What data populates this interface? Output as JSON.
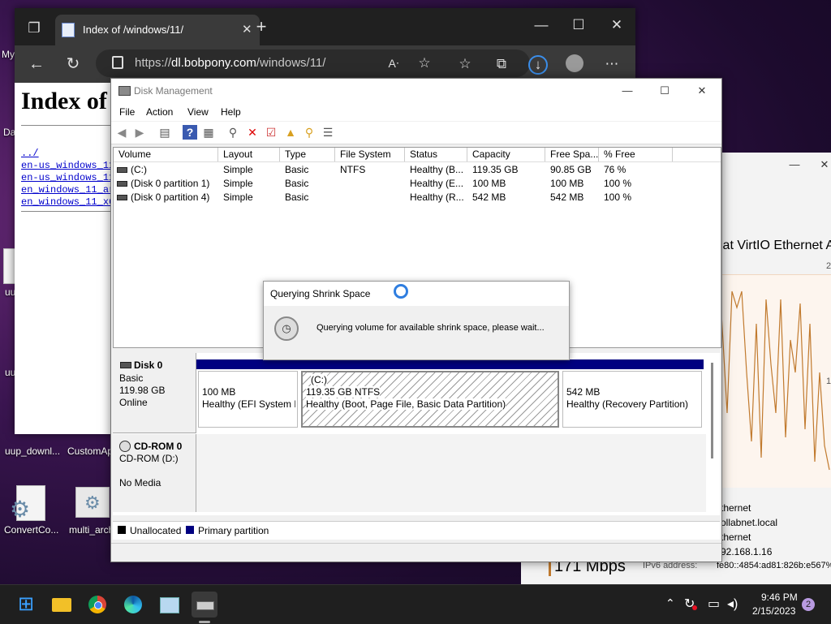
{
  "desktop": {
    "icons": [
      {
        "label": "My"
      },
      {
        "label": "Da"
      },
      {
        "label": "uu"
      },
      {
        "label": "uu"
      },
      {
        "label": "uup_downl..."
      },
      {
        "label": "CustomAp"
      },
      {
        "label": "ConvertCo..."
      },
      {
        "label": "multi_arch"
      }
    ]
  },
  "browser": {
    "tab_title": "Index of /windows/11/",
    "url_prefix": "https://",
    "url_host": "dl.bobpony.com",
    "url_path": "/windows/11/",
    "page_heading": "Index of",
    "links": [
      "../",
      "en-us_windows_11",
      "en-us_windows_11",
      "en_windows_11_ar",
      "en_windows_11_x6"
    ]
  },
  "network_window": {
    "adapter_title": "lat VirtIO Ethernet A",
    "scale_top": "2",
    "scale_mid": "1",
    "props": [
      "thernet",
      "ollabnet.local",
      "thernet",
      "92.168.1.16"
    ],
    "speed": "171 Mbps",
    "ipv6_label": "IPv6 address:",
    "ipv6_value": "fe80::4854:ad81:826b:e567%"
  },
  "disk_mgmt": {
    "title": "Disk Management",
    "menu": [
      "File",
      "Action",
      "View",
      "Help"
    ],
    "columns": [
      "Volume",
      "Layout",
      "Type",
      "File System",
      "Status",
      "Capacity",
      "Free Spa...",
      "% Free"
    ],
    "rows": [
      [
        "(C:)",
        "Simple",
        "Basic",
        "NTFS",
        "Healthy (B...",
        "119.35 GB",
        "90.85 GB",
        "76 %"
      ],
      [
        "(Disk 0 partition 1)",
        "Simple",
        "Basic",
        "",
        "Healthy (E...",
        "100 MB",
        "100 MB",
        "100 %"
      ],
      [
        "(Disk 0 partition 4)",
        "Simple",
        "Basic",
        "",
        "Healthy (R...",
        "542 MB",
        "542 MB",
        "100 %"
      ]
    ],
    "disk0": {
      "name": "Disk 0",
      "type": "Basic",
      "size": "119.98 GB",
      "state": "Online",
      "partitions": [
        {
          "size": "100 MB",
          "status": "Healthy (EFI System P"
        },
        {
          "name": "(C:)",
          "size": "119.35 GB NTFS",
          "status": "Healthy (Boot, Page File, Basic Data Partition)"
        },
        {
          "size": "542 MB",
          "status": "Healthy (Recovery Partition)"
        }
      ]
    },
    "cdrom0": {
      "name": "CD-ROM 0",
      "drive": "CD-ROM (D:)",
      "media": "No Media"
    },
    "legend": {
      "unallocated": "Unallocated",
      "primary": "Primary partition"
    },
    "colors": {
      "primary": "#000080",
      "unallocated": "#000000"
    }
  },
  "dialog": {
    "title": "Querying Shrink Space",
    "message": "Querying volume for available shrink space, please wait..."
  },
  "taskbar": {
    "time": "9:46 PM",
    "date": "2/15/2023",
    "notifications": "2"
  }
}
